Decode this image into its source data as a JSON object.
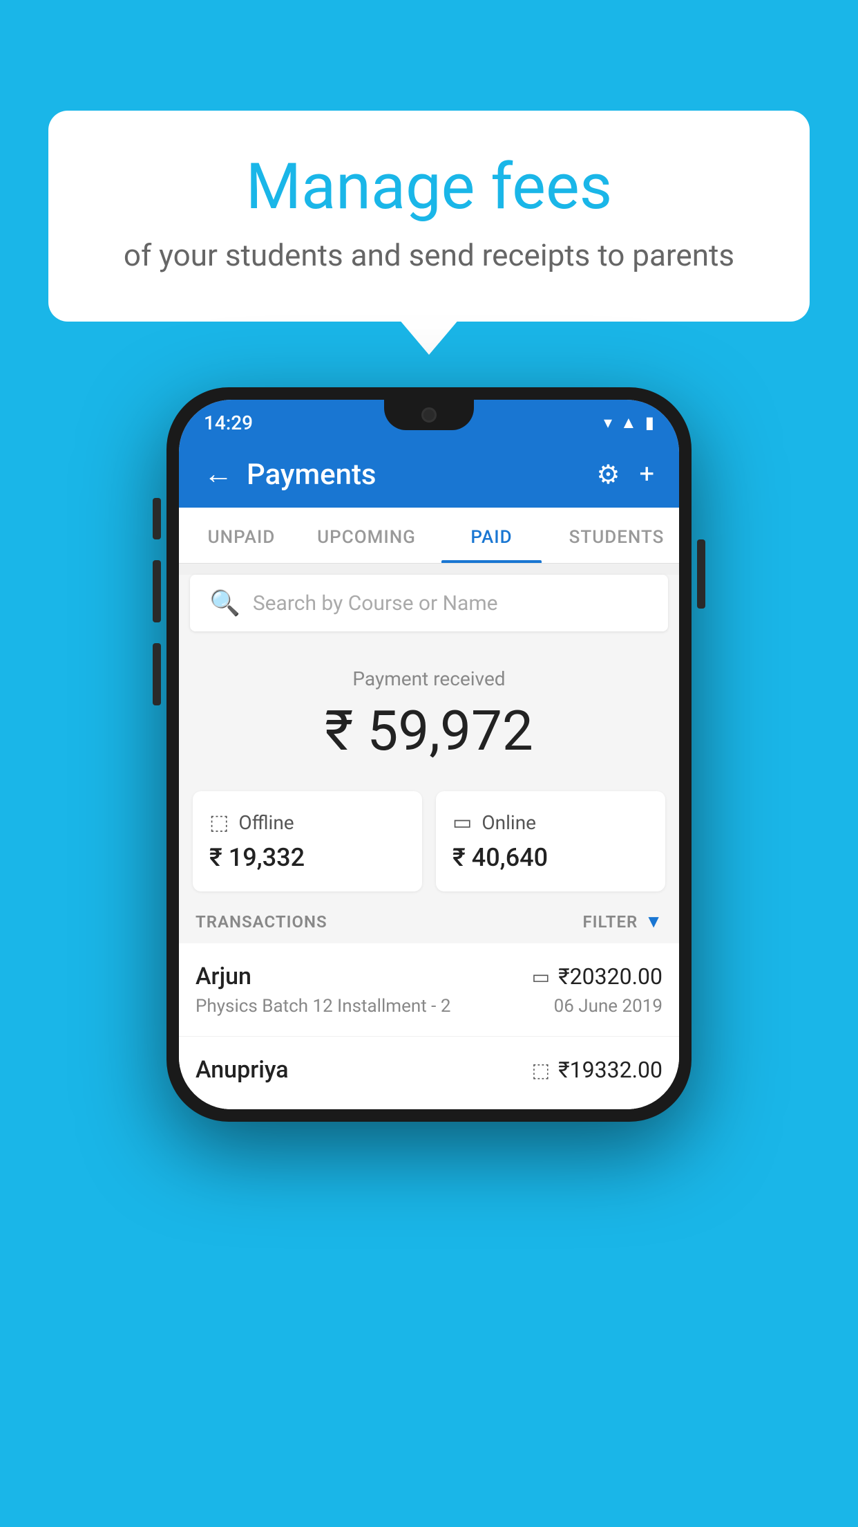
{
  "background_color": "#1ab6e8",
  "speech_bubble": {
    "title": "Manage fees",
    "subtitle": "of your students and send receipts to parents"
  },
  "status_bar": {
    "time": "14:29",
    "icons": [
      "wifi",
      "signal",
      "battery"
    ]
  },
  "header": {
    "title": "Payments",
    "back_label": "←",
    "settings_icon": "⚙",
    "add_icon": "+"
  },
  "tabs": [
    {
      "label": "UNPAID",
      "active": false
    },
    {
      "label": "UPCOMING",
      "active": false
    },
    {
      "label": "PAID",
      "active": true
    },
    {
      "label": "STUDENTS",
      "active": false
    }
  ],
  "search": {
    "placeholder": "Search by Course or Name"
  },
  "payment_received": {
    "label": "Payment received",
    "amount": "₹ 59,972"
  },
  "payment_cards": [
    {
      "icon": "offline",
      "label": "Offline",
      "amount": "₹ 19,332"
    },
    {
      "icon": "online",
      "label": "Online",
      "amount": "₹ 40,640"
    }
  ],
  "transactions_section": {
    "label": "TRANSACTIONS",
    "filter_label": "FILTER",
    "rows": [
      {
        "name": "Arjun",
        "detail": "Physics Batch 12 Installment - 2",
        "amount": "₹20320.00",
        "date": "06 June 2019",
        "mode_icon": "card"
      },
      {
        "name": "Anupriya",
        "detail": "",
        "amount": "₹19332.00",
        "date": "",
        "mode_icon": "offline"
      }
    ]
  }
}
